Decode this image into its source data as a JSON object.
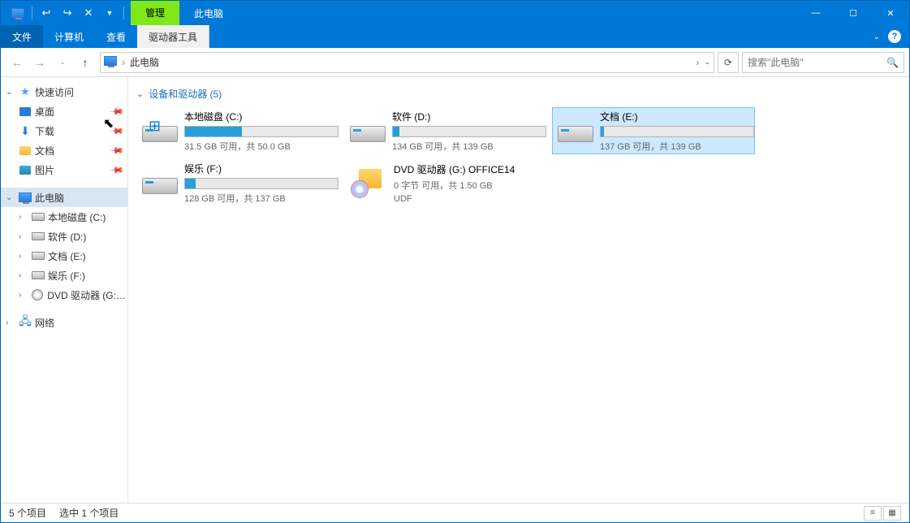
{
  "titlebar": {
    "context_tab": "管理",
    "title": "此电脑"
  },
  "ribbon": {
    "file": "文件",
    "tabs": [
      "计算机",
      "查看"
    ],
    "context_tab": "驱动器工具"
  },
  "nav": {
    "breadcrumb": "此电脑",
    "search_placeholder": "搜索\"此电脑\""
  },
  "sidebar": {
    "quick_access": "快速访问",
    "quick_items": [
      {
        "label": "桌面"
      },
      {
        "label": "下载"
      },
      {
        "label": "文档"
      },
      {
        "label": "图片"
      }
    ],
    "this_pc": "此电脑",
    "drives": [
      {
        "label": "本地磁盘 (C:)"
      },
      {
        "label": "软件 (D:)"
      },
      {
        "label": "文档 (E:)"
      },
      {
        "label": "娱乐 (F:)"
      },
      {
        "label": "DVD 驱动器 (G:) O"
      }
    ],
    "network": "网络"
  },
  "content": {
    "group_header": "设备和驱动器 (5)",
    "drives": [
      {
        "name": "本地磁盘 (C:)",
        "status": "31.5 GB 可用，共 50.0 GB",
        "fill": 37,
        "os": true,
        "selected": false
      },
      {
        "name": "软件 (D:)",
        "status": "134 GB 可用，共 139 GB",
        "fill": 4,
        "os": false,
        "selected": false
      },
      {
        "name": "文档 (E:)",
        "status": "137 GB 可用，共 139 GB",
        "fill": 2,
        "os": false,
        "selected": true
      },
      {
        "name": "娱乐 (F:)",
        "status": "128 GB 可用，共 137 GB",
        "fill": 7,
        "os": false,
        "selected": false
      }
    ],
    "dvd": {
      "name": "DVD 驱动器 (G:) OFFICE14",
      "status": "0 字节 可用，共 1.50 GB",
      "fs": "UDF"
    }
  },
  "statusbar": {
    "count": "5 个项目",
    "selection": "选中 1 个项目"
  }
}
